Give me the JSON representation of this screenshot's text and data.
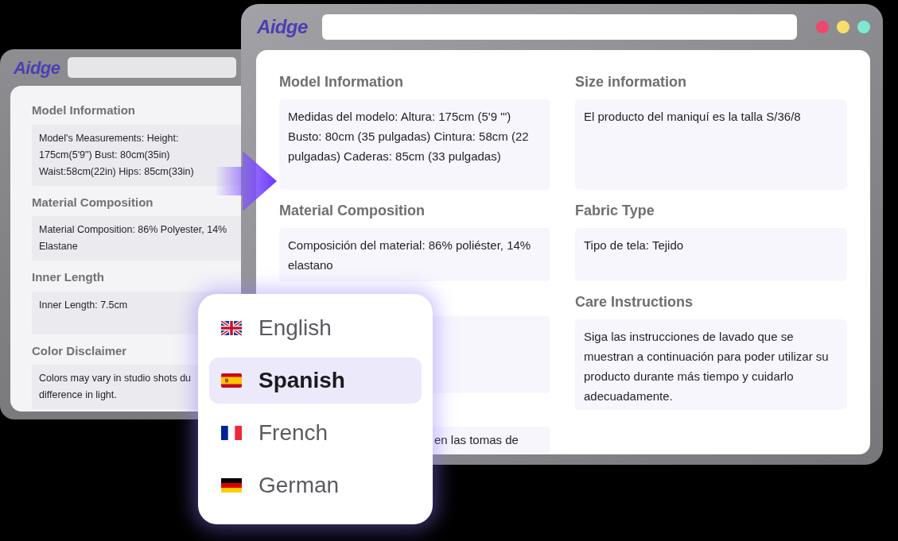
{
  "source_window": {
    "logo": "Aidge",
    "sections": [
      {
        "heading": "Model Information",
        "lines": [
          "Model's Measurements: Height:",
          "175cm(5'9\") Bust: 80cm(35in)",
          "Waist:58cm(22in) Hips: 85cm(33in)"
        ]
      },
      {
        "heading": "Material Composition",
        "lines": [
          "Material Composition: 86% Polyester, 14%",
          "Elastane"
        ]
      },
      {
        "heading": "Inner Length",
        "lines": [
          "Inner Length: 7.5cm"
        ]
      },
      {
        "heading": "Color Disclaimer",
        "lines": [
          "Colors may vary in studio shots du",
          "difference in light."
        ]
      }
    ]
  },
  "translated_window": {
    "logo": "Aidge",
    "left_column": [
      {
        "heading": "Model Information",
        "text": "Medidas del modelo: Altura: 175cm (5'9 \"') Busto: 80cm (35 pulgadas) Cintura: 58cm (22 pulgadas) Caderas: 85cm (33 pulgadas)"
      },
      {
        "heading": "Material Composition",
        "text": "Composición del material: 86% poliéster, 14% elastano"
      }
    ],
    "left_bottom_text": "en las tomas de",
    "right_column": [
      {
        "heading": "Size information",
        "text": "El producto del maniquí es la talla S/36/8"
      },
      {
        "heading": "Fabric Type",
        "text": "Tipo de tela: Tejido"
      },
      {
        "heading": "Care Instructions",
        "text": "Siga las instrucciones de lavado que se muestran a continuación para poder utilizar su producto durante más tiempo y cuidarlo adecuadamente."
      }
    ]
  },
  "language_menu": [
    {
      "kind": "gb",
      "label": "English",
      "selected": false
    },
    {
      "kind": "es",
      "label": "Spanish",
      "selected": true
    },
    {
      "kind": "fr",
      "label": "French",
      "selected": false
    },
    {
      "kind": "de",
      "label": "German",
      "selected": false
    }
  ]
}
